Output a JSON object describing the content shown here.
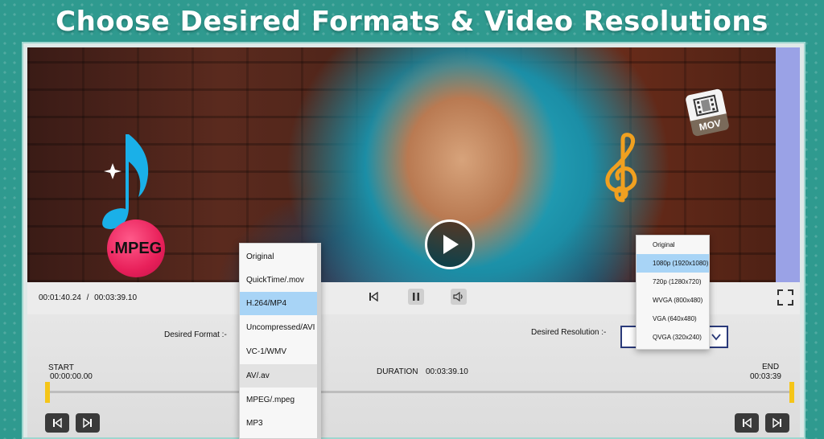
{
  "headline": "Choose Desired Formats & Video Resolutions",
  "badges": {
    "mov": "MOV",
    "mpeg": ".MPEG"
  },
  "player": {
    "current_time": "00:01:40.24",
    "separator": "/",
    "total_time": "00:03:39.10"
  },
  "settings": {
    "format_label": "Desired Format :-",
    "resolution_label": "Desired Resolution :-",
    "start_label": "START",
    "start_time": "00:00:00.00",
    "duration_label": "DURATION",
    "duration_value": "00:03:39.10",
    "end_label": "END",
    "end_time": "00:03:39"
  },
  "format_dropdown": {
    "options": [
      "Original",
      "QuickTime/.mov",
      "H.264/MP4",
      "Uncompressed/AVI",
      "VC-1/WMV",
      "AV/.av",
      "MPEG/.mpeg",
      "MP3"
    ],
    "selected": "H.264/MP4",
    "hovered": "AV/.av"
  },
  "resolution_dropdown": {
    "options": [
      "Original",
      "1080p (1920x1080)",
      "720p (1280x720)",
      "WVGA (800x480)",
      "VGA (640x480)",
      "QVGA (320x240)"
    ],
    "selected": "1080p (1920x1080)"
  },
  "colors": {
    "background": "#2f9a8f",
    "selection": "#a8d4f6",
    "trim_handle": "#f5c518",
    "mpeg_badge": "#e8205a",
    "note_blue": "#1ab0e8",
    "note_orange": "#f0a020"
  },
  "icons": {
    "play": "play-icon",
    "previous": "skip-back-icon",
    "pause": "pause-icon",
    "volume": "volume-icon",
    "fullscreen": "fullscreen-icon",
    "music_note": "music-note-icon",
    "treble_clef": "treble-clef-icon",
    "film": "film-icon"
  }
}
